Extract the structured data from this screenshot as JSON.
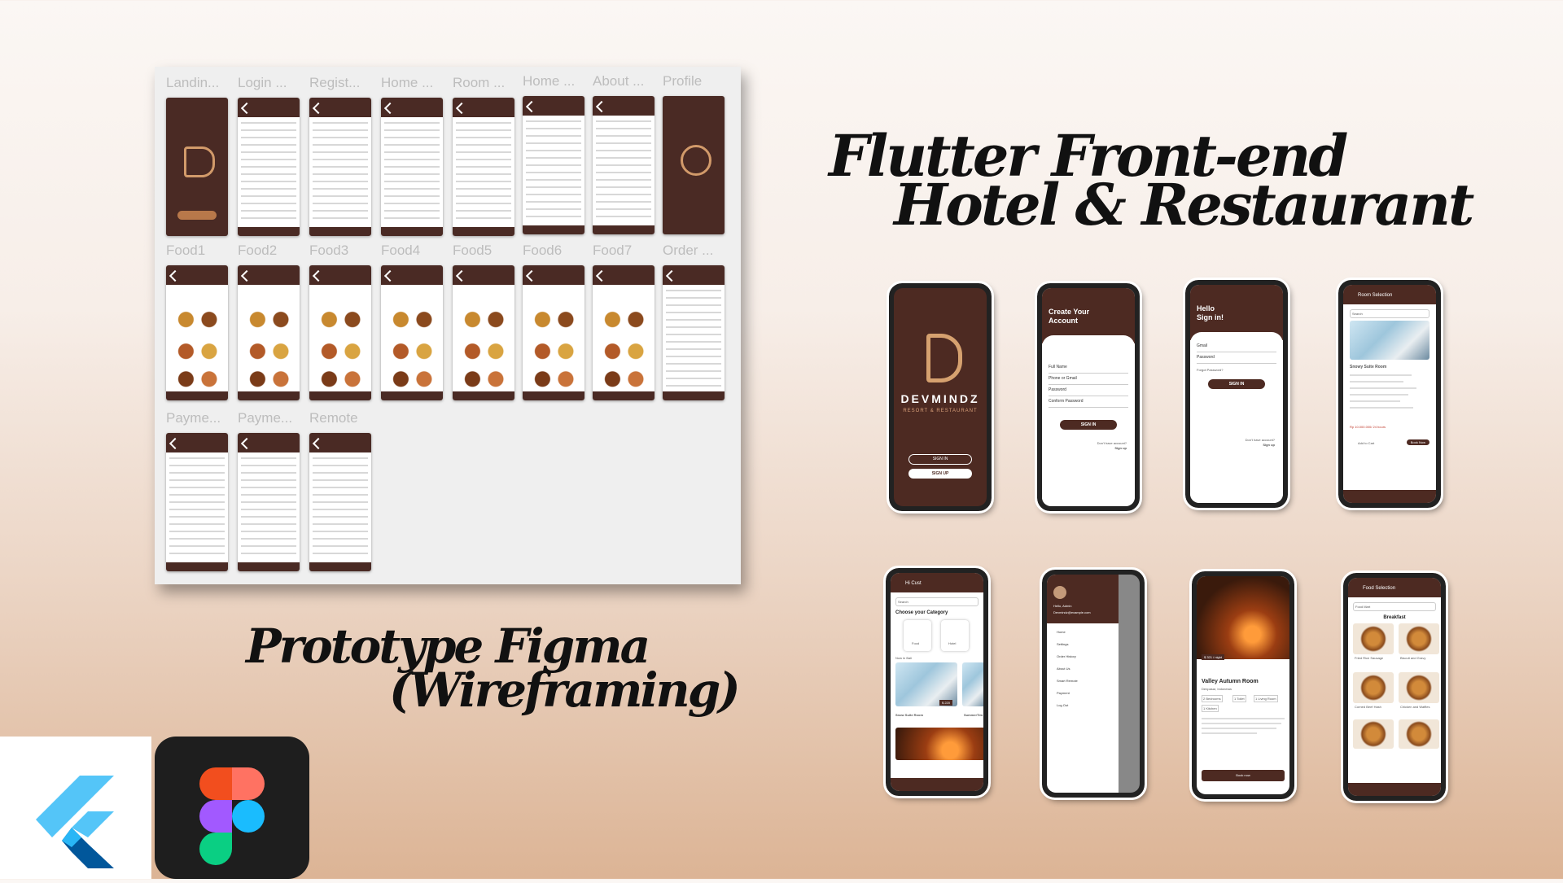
{
  "heading": {
    "line1": "Flutter Front-end",
    "line2": "Hotel & Restaurant"
  },
  "subheading": {
    "line1": "Prototype Figma",
    "line2": "(Wireframing)"
  },
  "board": {
    "row1": [
      "Landin...",
      "Login ...",
      "Regist...",
      "Home ...",
      "Room ...",
      "Home ...",
      "About ...",
      "Profile"
    ],
    "row2": [
      "Food1",
      "Food2",
      "Food3",
      "Food4",
      "Food5",
      "Food6",
      "Food7",
      "Order ..."
    ],
    "row3": [
      "Payme...",
      "Payme...",
      "Remote"
    ]
  },
  "phones": {
    "landing": {
      "brand": "DEVMINDZ",
      "tagline": "RESORT & RESTAURANT",
      "signin": "SIGN IN",
      "signup": "SIGN UP"
    },
    "register": {
      "title": "Create Your Account",
      "fields": [
        "Full Name",
        "Phone or Gmail",
        "Password",
        "Conform Password"
      ],
      "button": "SIGN IN",
      "note": "Don't have account?",
      "link": "Sign up"
    },
    "login": {
      "title": "Hello Sign in!",
      "fields": [
        "Gmail",
        "Password"
      ],
      "forgot": "Forgot Password?",
      "button": "SIGN IN",
      "note": "Don't have account?",
      "link": "Sign up"
    },
    "room": {
      "title": "Room Selection",
      "search": "Search",
      "name": "Snowy Suite Room",
      "price": "Rp 10.000.000/ 24 hours",
      "add": "Add to Cart",
      "book": "Book Now"
    },
    "home": {
      "title": "Hi Cust",
      "search": "Search",
      "category": "Choose your Category",
      "cat1": "Food",
      "cat2": "Hotel",
      "now": "Now in Bali",
      "room": "Snow Suite Room",
      "price": "$ 220",
      "room2": "SummerTim"
    },
    "drawer": {
      "user": "Hello, Admin",
      "email": "Devmindz@example.com",
      "items": [
        "Home",
        "Settings",
        "Order History",
        "About Us",
        "Smart Remote",
        "Payment",
        "Log Out"
      ]
    },
    "detail": {
      "price": "$ 321 / night",
      "name": "Valley Autumn Room",
      "place": "Denpasar, Indonesia",
      "tags": [
        "2 Bedrooms",
        "1 Toilet",
        "1 Living Room",
        "1 Kitchen"
      ],
      "book": "Book now"
    },
    "food": {
      "title": "Food Selection",
      "search": "Food Mart",
      "section": "Breakfast",
      "items": [
        "Fried Rice Sausage",
        "Biscuit and Gravy",
        "Corned Beef Hash",
        "Chicken and Waffles"
      ]
    }
  }
}
